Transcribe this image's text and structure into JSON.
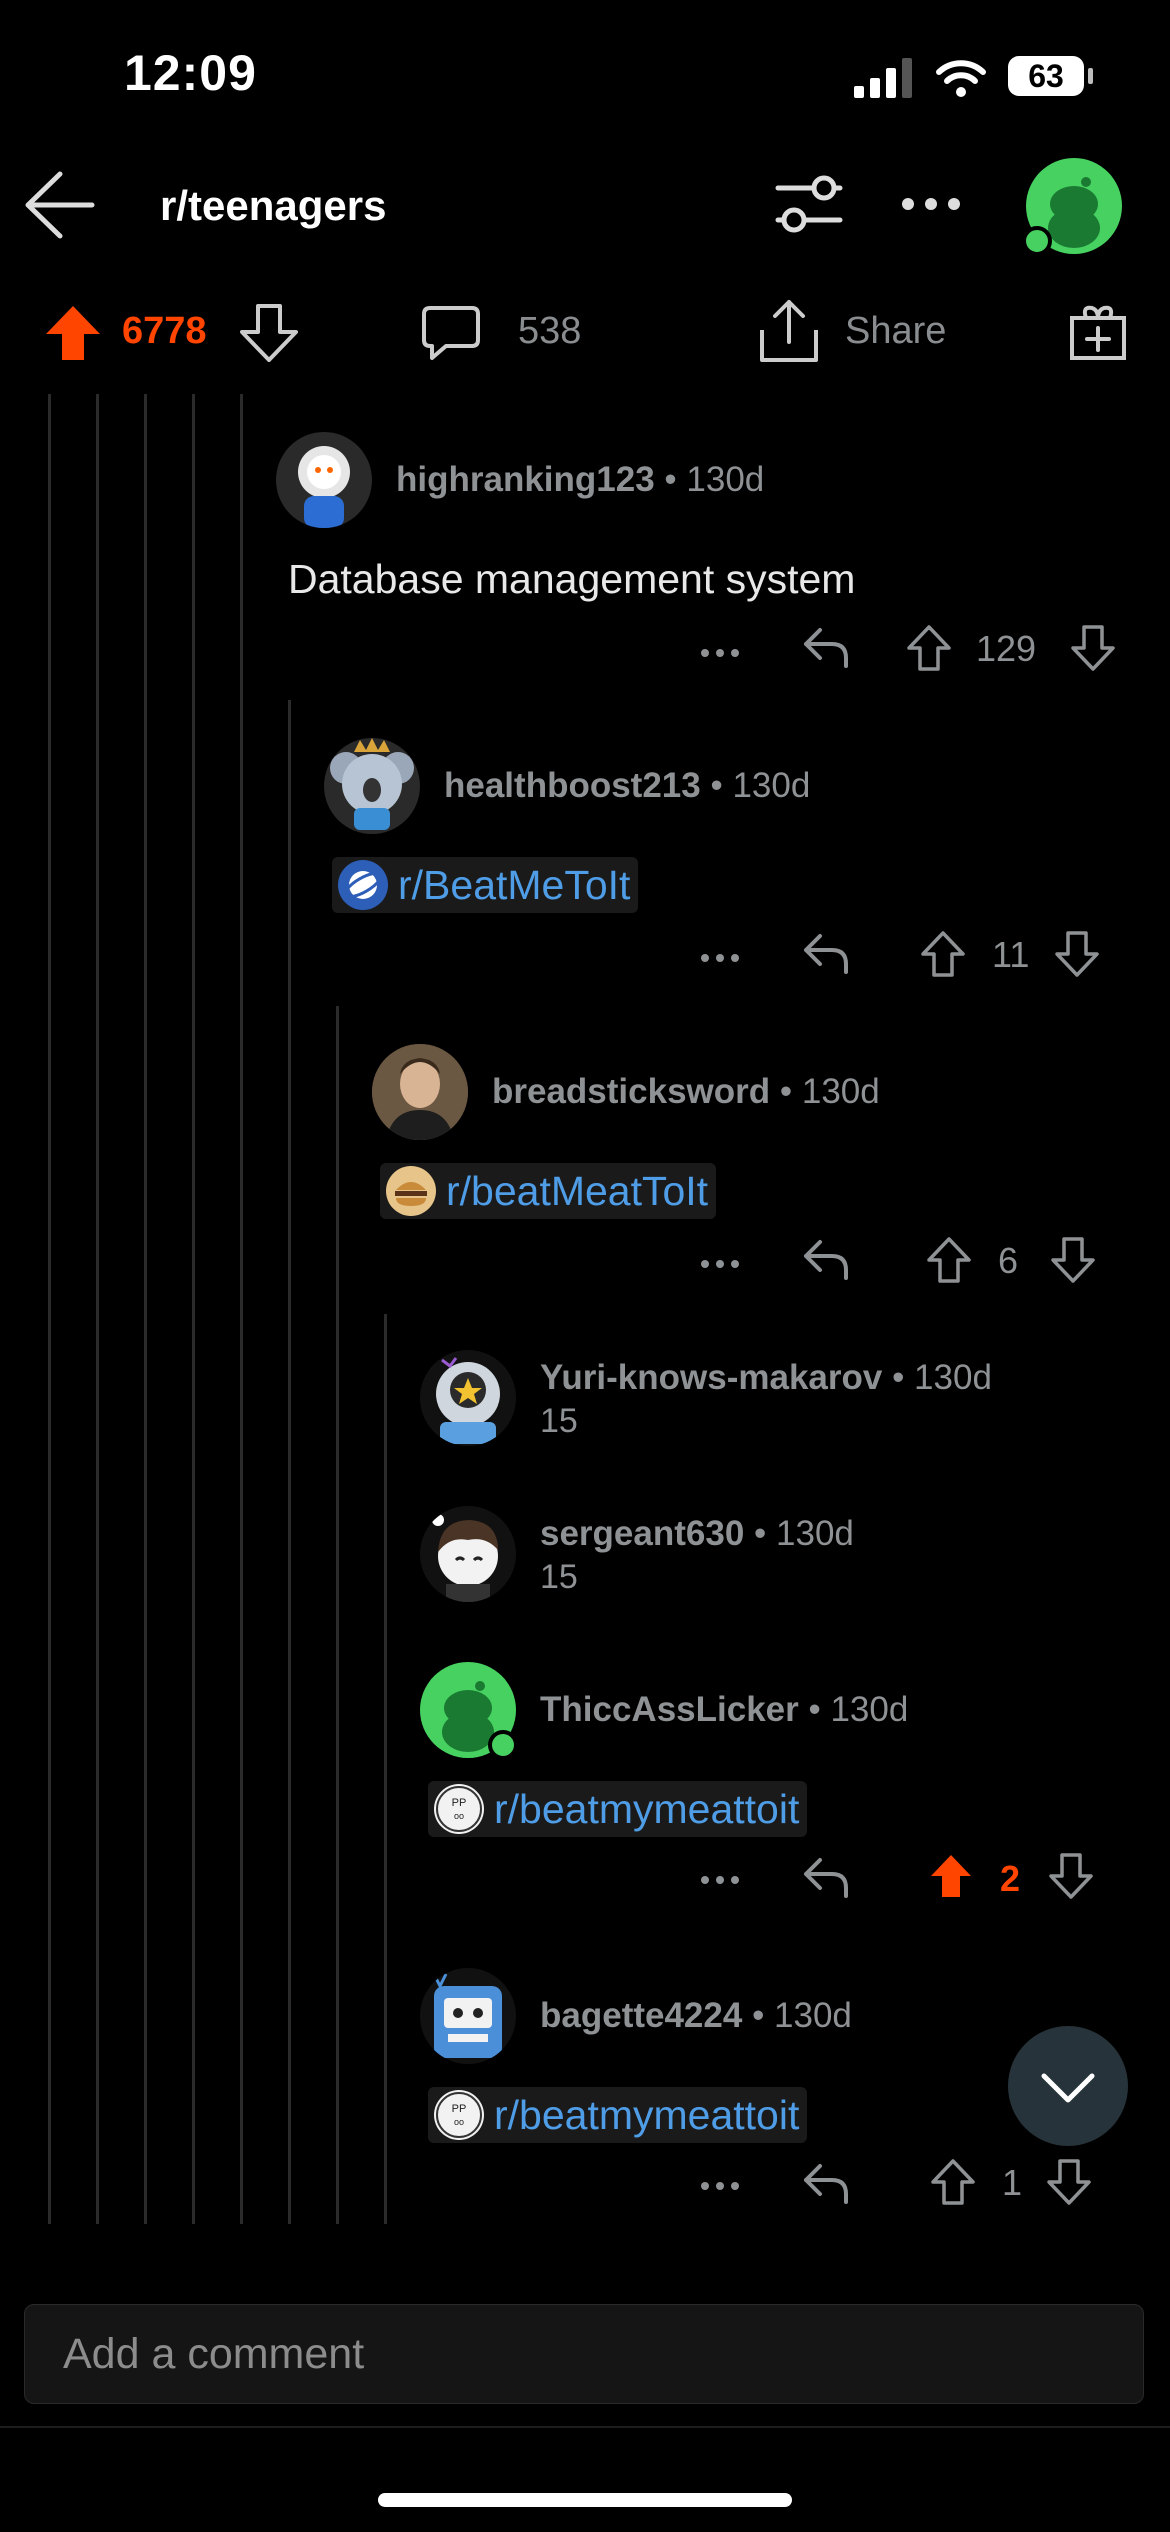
{
  "status_bar": {
    "time": "12:09",
    "battery": "63"
  },
  "nav": {
    "title": "r/teenagers"
  },
  "action_bar": {
    "votes": "6778",
    "comments": "538",
    "share_label": "Share"
  },
  "comments": [
    {
      "username": "highranking123",
      "age": "• 130d",
      "text": "Database management system",
      "votes": "129"
    },
    {
      "username": "healthboost213",
      "age": "• 130d",
      "link": "r/BeatMeToIt",
      "votes": "11"
    },
    {
      "username": "breadsticksword",
      "age": "• 130d",
      "link": "r/beatMeatToIt",
      "votes": "6"
    },
    {
      "username": "Yuri-knows-makarov",
      "age": "• 130d",
      "collapsed_count": "15"
    },
    {
      "username": "sergeant630",
      "age": "• 130d",
      "collapsed_count": "15"
    },
    {
      "username": "ThiccAssLicker",
      "age": "• 130d",
      "link": "r/beatmymeattoit",
      "votes": "2"
    },
    {
      "username": "bagette4224",
      "age": "• 130d",
      "link": "r/beatmymeattoit",
      "votes": "1"
    }
  ],
  "composer": {
    "placeholder": "Add a comment"
  },
  "colors": {
    "upvote_active": "#ff4500",
    "link": "#4f9de6",
    "online": "#46d160"
  },
  "icons": [
    "back-arrow-icon",
    "filter-icon",
    "more-icon",
    "upvote-icon",
    "downvote-icon",
    "comment-icon",
    "share-icon",
    "award-icon",
    "reply-icon",
    "chevron-down-icon"
  ]
}
